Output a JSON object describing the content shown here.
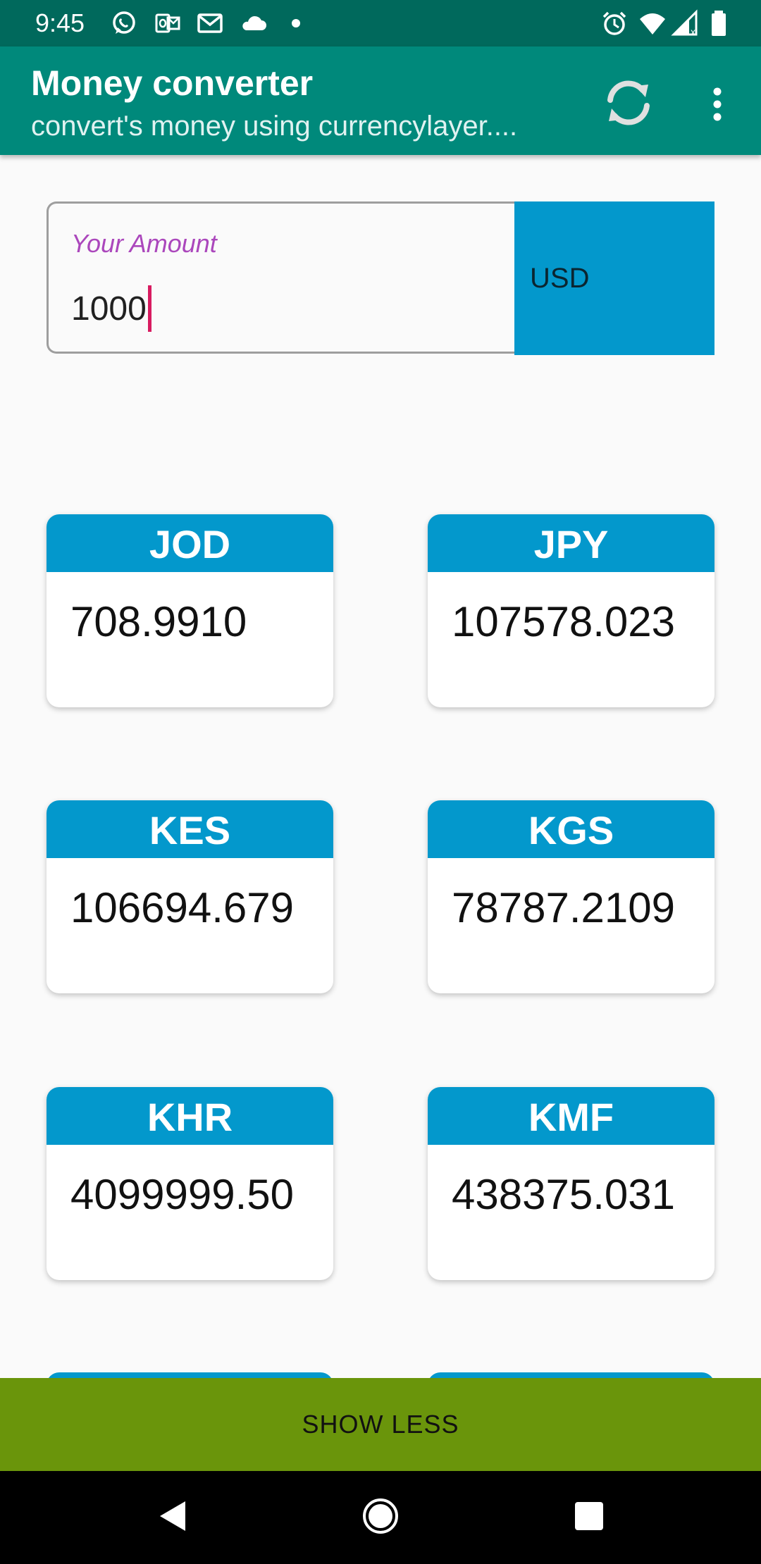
{
  "status_bar": {
    "time": "9:45",
    "icons": [
      "whatsapp-icon",
      "outlook-icon",
      "gmail-icon",
      "cloud-icon",
      "notification-dot-icon",
      "alarm-icon",
      "wifi-icon",
      "signal-icon",
      "battery-icon"
    ]
  },
  "app_bar": {
    "title": "Money converter",
    "subtitle": "convert's money using currencylayer....",
    "actions": [
      "refresh-icon",
      "more-vert-icon"
    ]
  },
  "amount": {
    "label": "Your Amount",
    "value": "1000"
  },
  "base_currency": {
    "selected": "USD"
  },
  "cards": [
    {
      "code": "JOD",
      "value": "708.9910"
    },
    {
      "code": "JPY",
      "value": "107578.023"
    },
    {
      "code": "KES",
      "value": "106694.679"
    },
    {
      "code": "KGS",
      "value": "78787.2109"
    },
    {
      "code": "KHR",
      "value": "4099999.50"
    },
    {
      "code": "KMF",
      "value": "438375.031"
    }
  ],
  "footer": {
    "show_less_label": "SHOW LESS"
  },
  "nav_bar": {
    "buttons": [
      "back-icon",
      "home-icon",
      "recents-icon"
    ]
  },
  "colors": {
    "status_bar": "#00695c",
    "app_bar": "#00897b",
    "accent_blue": "#0398cc",
    "show_less_green": "#6a950b",
    "label_purple": "#ab47bc",
    "caret_pink": "#d81b60"
  }
}
